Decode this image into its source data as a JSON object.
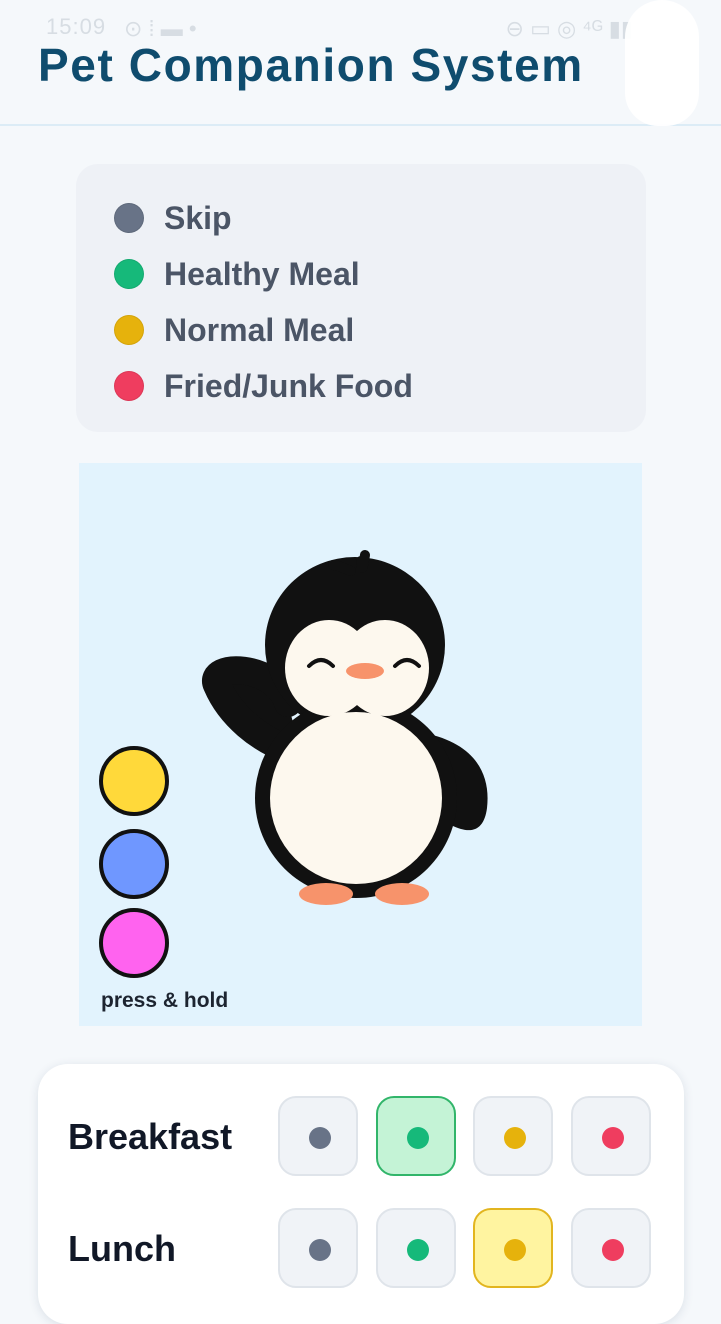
{
  "status": {
    "time": "15:09",
    "left_icons": "⊙ ⁞ ▬ •",
    "right_icons": "⊖ ▭ ◎ ⁴ᴳ ▮▮"
  },
  "header": {
    "title": "Pet Companion System"
  },
  "legend": {
    "items": [
      {
        "label": "Skip",
        "color": "#687387"
      },
      {
        "label": "Healthy Meal",
        "color": "#16b97a"
      },
      {
        "label": "Normal Meal",
        "color": "#e6b20c"
      },
      {
        "label": "Fried/Junk Food",
        "color": "#ef3d5f"
      }
    ]
  },
  "pet": {
    "icon": "penguin-waving",
    "color_buttons": [
      {
        "color": "#ffd93a"
      },
      {
        "color": "#6f97ff"
      },
      {
        "color": "#ff63ef"
      }
    ],
    "hint": "press & hold"
  },
  "meals": [
    {
      "label": "Breakfast",
      "selected": "Healthy Meal"
    },
    {
      "label": "Lunch",
      "selected": "Normal Meal"
    }
  ]
}
